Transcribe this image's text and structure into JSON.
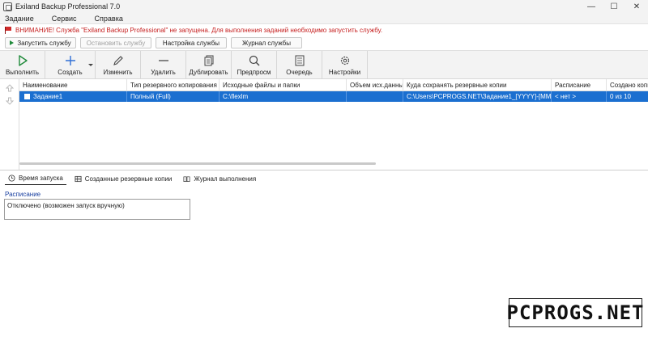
{
  "window": {
    "title": "Exiland Backup Professional 7.0",
    "minimize": "—",
    "maximize": "☐",
    "close": "✕"
  },
  "menu": [
    "Задание",
    "Сервис",
    "Справка"
  ],
  "warning": {
    "text": "ВНИМАНИЕ! Служба \"Exiland Backup Professional\" не запущена. Для выполнения заданий необходимо запустить службу.",
    "color": "#c62020"
  },
  "service_buttons": {
    "start": "Запустить службу",
    "stop": "Остановить службу",
    "settings": "Настройка службы",
    "journal": "Журнал службы"
  },
  "toolbar": {
    "run": "Выполнить",
    "create": "Создать",
    "edit": "Изменить",
    "delete": "Удалить",
    "duplicate": "Дублировать",
    "preview": "Предпросм",
    "queue": "Очередь",
    "settings": "Настройки"
  },
  "grid": {
    "columns": [
      "Наименование",
      "Тип резервного копирования",
      "Исходные файлы и папки",
      "Объем исх.данных",
      "Куда сохранять резервные копии",
      "Расписание",
      "Создано копи"
    ],
    "rows": [
      {
        "name": "Задание1",
        "type": "Полный (Full)",
        "source": "C:\\flexlm",
        "size": "",
        "destination": "C:\\Users\\PCPROGS.NET\\Задание1_[YYYY]-[MM]-[D...",
        "schedule": "< нет >",
        "created": "0 из 10"
      }
    ],
    "accent": "#1b6fd0"
  },
  "tabs": [
    "Время запуска",
    "Созданные резервные копии",
    "Журнал выполнения"
  ],
  "schedule": {
    "label": "Расписание",
    "value": "Отключено (возможен запуск вручную)"
  },
  "watermark": "PCPROGS.NET"
}
